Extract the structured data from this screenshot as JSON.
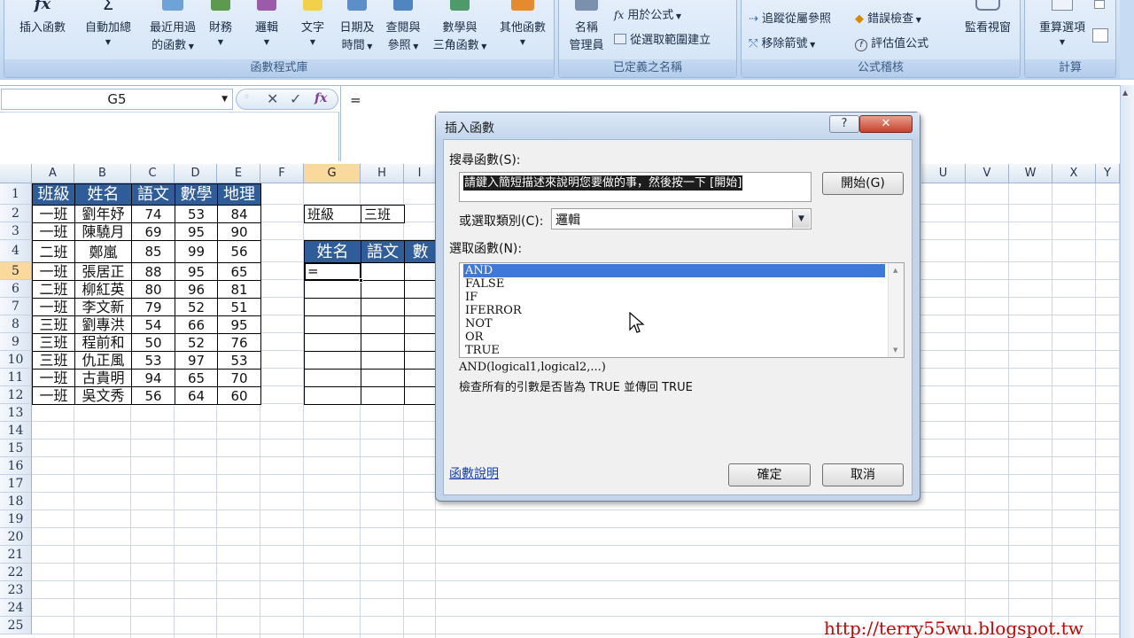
{
  "ribbon": {
    "insert_function": "插入函數",
    "autosum": "自動加總",
    "recent": [
      "最近用過",
      "的函數"
    ],
    "financial": "財務",
    "logical": "邏輯",
    "text": "文字",
    "datetime": [
      "日期及",
      "時間"
    ],
    "lookup": [
      "查閱與",
      "參照"
    ],
    "math": [
      "數學與",
      "三角函數"
    ],
    "more": "其他函數",
    "group_library": "函數程式庫",
    "name_manager": [
      "名稱",
      "管理員"
    ],
    "use_in_formula": "用於公式",
    "create_from_selection": "從選取範圍建立",
    "group_defined_names": "已定義之名稱",
    "trace_precedents": "追蹤從屬參照",
    "remove_arrows": "移除箭號",
    "error_checking": "錯誤檢查",
    "evaluate_formula": "評估值公式",
    "watch_window": "監看視窗",
    "group_auditing": "公式稽核",
    "calc_options": "重算選項",
    "group_calc": "計算"
  },
  "formula_bar": {
    "name_box": "G5",
    "content": "="
  },
  "columns": [
    "A",
    "B",
    "C",
    "D",
    "E",
    "F",
    "G",
    "H",
    "I",
    "U",
    "V",
    "W",
    "X",
    "Y"
  ],
  "rows": [
    "1",
    "2",
    "3",
    "4",
    "5",
    "6",
    "7",
    "8",
    "9",
    "10",
    "11",
    "12",
    "13",
    "14",
    "15",
    "16",
    "17",
    "18",
    "19",
    "20",
    "21",
    "22",
    "23",
    "24",
    "25"
  ],
  "table": {
    "headers": [
      "班級",
      "姓名",
      "語文",
      "數學",
      "地理"
    ],
    "data": [
      [
        "一班",
        "劉年妤",
        "74",
        "53",
        "84"
      ],
      [
        "一班",
        "陳驍月",
        "69",
        "95",
        "90"
      ],
      [
        "二班",
        "鄭嵐",
        "85",
        "99",
        "56"
      ],
      [
        "一班",
        "張居正",
        "88",
        "95",
        "65"
      ],
      [
        "二班",
        "柳紅英",
        "80",
        "96",
        "81"
      ],
      [
        "一班",
        "李文新",
        "79",
        "52",
        "51"
      ],
      [
        "三班",
        "劉專洪",
        "54",
        "66",
        "95"
      ],
      [
        "三班",
        "程前和",
        "50",
        "52",
        "76"
      ],
      [
        "三班",
        "仇正風",
        "53",
        "97",
        "53"
      ],
      [
        "一班",
        "古貴明",
        "94",
        "65",
        "70"
      ],
      [
        "一班",
        "吳文秀",
        "56",
        "64",
        "60"
      ]
    ]
  },
  "criteria": {
    "label": "班級",
    "value": "三班",
    "headers": [
      "姓名",
      "語文",
      "數學"
    ],
    "g5_value": "="
  },
  "dialog": {
    "title": "插入函數",
    "search_label": "搜尋函數(S):",
    "search_value": "請鍵入簡短描述來說明您要做的事，然後按一下 [開始]",
    "go_button": "開始(G)",
    "category_label": "或選取類別(C):",
    "category_value": "邏輯",
    "select_label": "選取函數(N):",
    "functions": [
      "AND",
      "FALSE",
      "IF",
      "IFERROR",
      "NOT",
      "OR",
      "TRUE"
    ],
    "selected_index": 0,
    "syntax": "AND(logical1,logical2,...)",
    "description": "檢查所有的引數是否皆為 TRUE 並傳回 TRUE",
    "help_link": "函數說明",
    "ok": "確定",
    "cancel": "取消"
  },
  "watermark": "http://terry55wu.blogspot.tw",
  "colors": {
    "header_fill": "#2f5d9a",
    "selection": "#3e78d8",
    "ribbon": "#c7dbf2"
  }
}
